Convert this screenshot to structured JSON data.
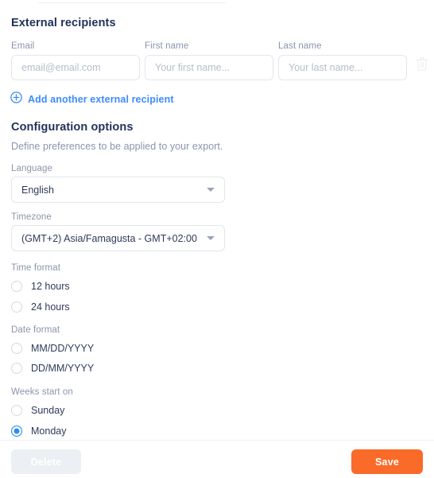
{
  "external_recipients": {
    "title": "External recipients",
    "fields": [
      {
        "label": "Email",
        "value": "",
        "placeholder": "email@email.com"
      },
      {
        "label": "First name",
        "value": "",
        "placeholder": "Your first name..."
      },
      {
        "label": "Last name",
        "value": "",
        "placeholder": "Your last name..."
      }
    ],
    "delete_row_icon": "trash-icon",
    "add_link": {
      "icon": "circle-plus-icon",
      "label": "Add another external recipient",
      "color": "#3d8bfd"
    }
  },
  "configuration": {
    "title": "Configuration options",
    "subtitle": "Define preferences to be applied to your export.",
    "language": {
      "label": "Language",
      "value": "English"
    },
    "timezone": {
      "label": "Timezone",
      "value": "(GMT+2) Asia/Famagusta - GMT+02:00"
    },
    "time_format": {
      "label": "Time format",
      "options": [
        {
          "label": "12 hours",
          "selected": false
        },
        {
          "label": "24 hours",
          "selected": false
        }
      ]
    },
    "date_format": {
      "label": "Date format",
      "options": [
        {
          "label": "MM/DD/YYYY",
          "selected": false
        },
        {
          "label": "DD/MM/YYYY",
          "selected": false
        }
      ]
    },
    "weeks_start_on": {
      "label": "Weeks start on",
      "options": [
        {
          "label": "Sunday",
          "selected": false
        },
        {
          "label": "Monday",
          "selected": true
        }
      ]
    }
  },
  "footer": {
    "delete_label": "Delete",
    "save_label": "Save",
    "save_color": "#fa6a28",
    "delete_color": "#eceff3"
  }
}
